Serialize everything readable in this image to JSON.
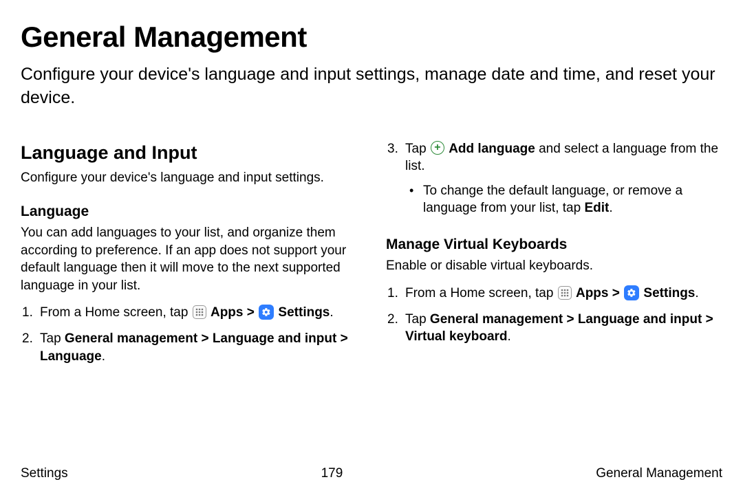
{
  "page": {
    "title": "General Management",
    "intro": "Configure your device's language and input settings, manage date and time, and reset your device."
  },
  "left": {
    "h2": "Language and Input",
    "desc": "Configure your device's language and input settings.",
    "h3": "Language",
    "body": "You can add languages to your list, and organize them according to preference. If an app does not support your default language then it will move to the next supported language in your list.",
    "step1_pre": "From a Home screen, tap ",
    "apps_label": "Apps",
    "chev1": " > ",
    "settings_label": "Settings",
    "period": ".",
    "step2_pre": "Tap ",
    "step2_path": "General management > Language and input > Language",
    "step2_post": "."
  },
  "right": {
    "step3_pre": "Tap ",
    "add_label": "Add language",
    "step3_post": " and select a language from the list.",
    "bullet_pre": "To change the default language, or remove a language from your list, tap ",
    "bullet_bold": "Edit",
    "bullet_post": ".",
    "h3": "Manage Virtual Keyboards",
    "desc": "Enable or disable virtual keyboards.",
    "k_step1_pre": "From a Home screen, tap ",
    "k_apps_label": "Apps",
    "k_chev1": " > ",
    "k_settings_label": "Settings",
    "k_period": ".",
    "k_step2_pre": "Tap ",
    "k_step2_path": "General management > Language and input > Virtual keyboard",
    "k_step2_post": "."
  },
  "footer": {
    "left": "Settings",
    "center": "179",
    "right": "General Management"
  }
}
